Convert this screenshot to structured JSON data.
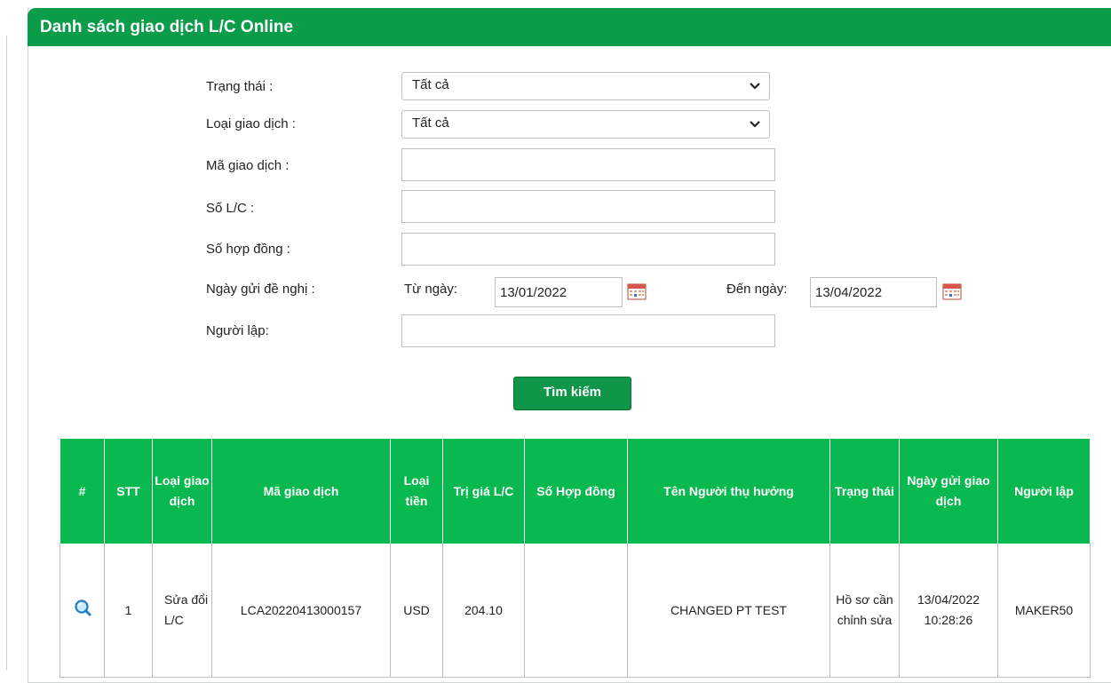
{
  "page": {
    "title": "Danh sách giao dịch L/C Online"
  },
  "filters": {
    "status_label": "Trạng thái :",
    "status_value": "Tất cả",
    "type_label": "Loại giao dịch :",
    "type_value": "Tất cả",
    "code_label": "Mã giao dịch :",
    "code_value": "",
    "lc_label": "Số L/C :",
    "lc_value": "",
    "contract_label": "Số hợp đồng :",
    "contract_value": "",
    "date_label": "Ngày gửi đề nghị :",
    "from_label": "Từ ngày:",
    "from_value": "13/01/2022",
    "to_label": "Đến ngày:",
    "to_value": "13/04/2022",
    "creator_label": "Người lập:",
    "creator_value": ""
  },
  "search_button": "Tìm kiếm",
  "table": {
    "headers": {
      "hash": "#",
      "stt": "STT",
      "type": "Loại giao dịch",
      "code": "Mã giao dịch",
      "currency": "Loại tiền",
      "value": "Trị giá L/C",
      "contract": "Số Hợp đồng",
      "beneficiary": "Tên Người thụ hưởng",
      "status": "Trạng thái",
      "date": "Ngày gửi giao dịch",
      "creator": "Người lập"
    },
    "rows": [
      {
        "stt": "1",
        "type": "Sửa đổi L/C",
        "code": "LCA20220413000157",
        "currency": "USD",
        "value": "204.10",
        "contract": "",
        "beneficiary": "CHANGED PT TEST",
        "status": "Hồ sơ cần chỉnh sửa",
        "date": "13/04/2022",
        "time": "10:28:26",
        "creator": "MAKER50"
      }
    ]
  },
  "icons": {
    "view": "magnifier-icon",
    "calendar": "calendar-icon",
    "dropdown": "chevron-down-icon"
  },
  "colors": {
    "header_green": "#0b9c4a",
    "table_header_green": "#09b94f",
    "button_green": "#109648"
  }
}
